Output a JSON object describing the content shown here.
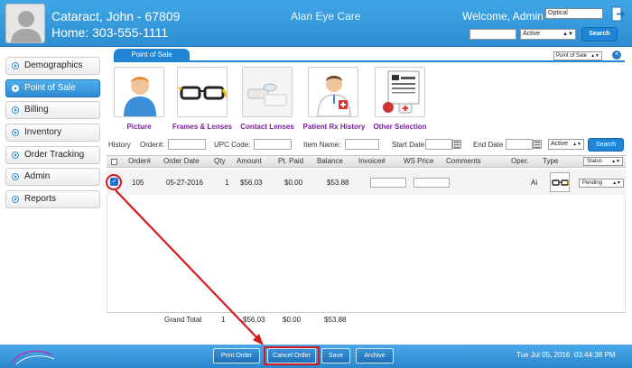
{
  "header": {
    "patient_name": "Cataract, John - 67809",
    "patient_phone": "Home: 303-555-1111",
    "clinic_name": "Alan Eye Care",
    "welcome": "Welcome, Admin",
    "store_select": "Optical",
    "status_select": "Active",
    "search_button": "Search",
    "colors": {
      "header_blue": "#2e8fd2",
      "accent_purple": "#7a1ea0",
      "highlight_red": "#d41a1a"
    }
  },
  "sidebar": {
    "items": [
      {
        "label": "Demographics"
      },
      {
        "label": "Point of Sale",
        "active": true
      },
      {
        "label": "Billing"
      },
      {
        "label": "Inventory"
      },
      {
        "label": "Order Tracking"
      },
      {
        "label": "Admin"
      },
      {
        "label": "Reports"
      }
    ]
  },
  "panel": {
    "tab_title": "Point of Sale",
    "view_select": "Point of Sale",
    "tiles": [
      {
        "label": "Picture",
        "icon": "person-icon"
      },
      {
        "label": "Frames & Lenses",
        "icon": "eyeglasses-icon"
      },
      {
        "label": "Contact Lenses",
        "icon": "contact-lens-icon"
      },
      {
        "label": "Patient Rx History",
        "icon": "doctor-icon"
      },
      {
        "label": "Other Selection",
        "icon": "eye-chart-icon"
      }
    ]
  },
  "filters": {
    "history": "History",
    "order_label": "Order#:",
    "upc_label": "UPC Code:",
    "item_label": "Item Name:",
    "start_label": "Start Date",
    "end_label": "End Date",
    "status": "Active",
    "search_button": "Search"
  },
  "table": {
    "headers": [
      "Order#",
      "Order Date",
      "Qty",
      "Amount",
      "Pt. Paid",
      "Balance",
      "Invoice#",
      "WS Price",
      "Comments",
      "Oper.",
      "Type"
    ],
    "status_header": "Status",
    "rows": [
      {
        "order": "105",
        "date": "05-27-2016",
        "qty": "1",
        "amount": "$56.03",
        "paid": "$0.00",
        "balance": "$53.88",
        "oper": "Ai",
        "status": "Pending"
      }
    ],
    "grand_total": {
      "label": "Grand Total",
      "qty": "1",
      "amount": "$56.03",
      "paid": "$0.00",
      "balance": "$53.88"
    }
  },
  "footer": {
    "buttons": [
      "Print Order",
      "Cancel Order",
      "Save",
      "Archive"
    ],
    "date": "Tue Jul 05, 2016",
    "time": "03:44:38 PM"
  }
}
